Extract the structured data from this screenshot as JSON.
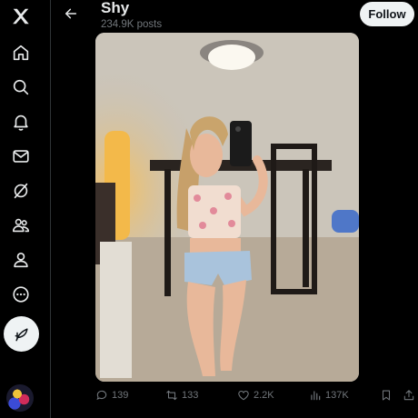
{
  "sidebar": {
    "logo": "x-logo-icon",
    "items": [
      {
        "icon": "home-icon"
      },
      {
        "icon": "search-icon"
      },
      {
        "icon": "bell-icon"
      },
      {
        "icon": "mail-icon"
      },
      {
        "icon": "grok-icon"
      },
      {
        "icon": "communities-icon"
      },
      {
        "icon": "profile-icon"
      },
      {
        "icon": "more-icon"
      }
    ],
    "post_button_icon": "compose-icon"
  },
  "header": {
    "title": "Shy",
    "subtitle": "234.9K posts",
    "follow_label": "Follow"
  },
  "actions": {
    "replies": "139",
    "reposts": "133",
    "likes": "2.2K",
    "views": "137K"
  },
  "colors": {
    "background": "#000000",
    "text": "#e7e9ea",
    "muted": "#71767b",
    "button": "#eff3f4"
  }
}
